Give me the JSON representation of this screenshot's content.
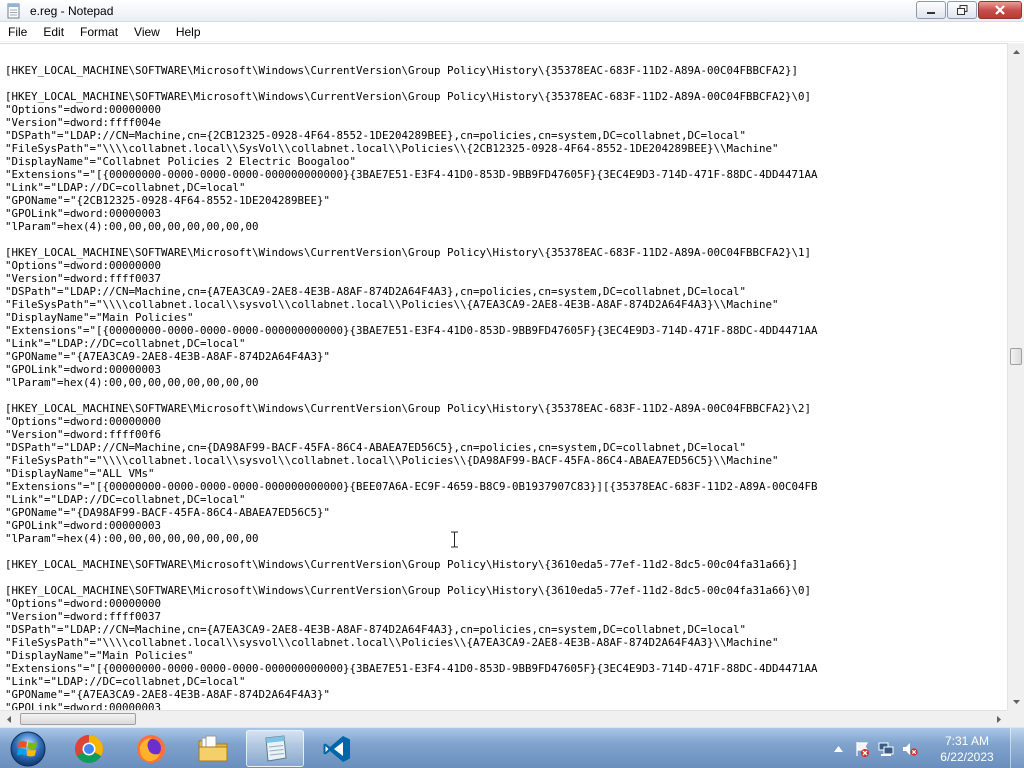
{
  "window": {
    "title": "e.reg - Notepad",
    "app_icon": "notepad-icon",
    "controls": [
      "minimize-icon",
      "maximize-icon",
      "close-icon"
    ]
  },
  "menu": [
    "File",
    "Edit",
    "Format",
    "View",
    "Help"
  ],
  "editor": {
    "lines": [
      "",
      "[HKEY_LOCAL_MACHINE\\SOFTWARE\\Microsoft\\Windows\\CurrentVersion\\Group Policy\\History\\{35378EAC-683F-11D2-A89A-00C04FBBCFA2}]",
      "",
      "[HKEY_LOCAL_MACHINE\\SOFTWARE\\Microsoft\\Windows\\CurrentVersion\\Group Policy\\History\\{35378EAC-683F-11D2-A89A-00C04FBBCFA2}\\0]",
      "\"Options\"=dword:00000000",
      "\"Version\"=dword:ffff004e",
      "\"DSPath\"=\"LDAP://CN=Machine,cn={2CB12325-0928-4F64-8552-1DE204289BEE},cn=policies,cn=system,DC=collabnet,DC=local\"",
      "\"FileSysPath\"=\"\\\\\\\\collabnet.local\\\\SysVol\\\\collabnet.local\\\\Policies\\\\{2CB12325-0928-4F64-8552-1DE204289BEE}\\\\Machine\"",
      "\"DisplayName\"=\"Collabnet Policies 2 Electric Boogaloo\"",
      "\"Extensions\"=\"[{00000000-0000-0000-0000-000000000000}{3BAE7E51-E3F4-41D0-853D-9BB9FD47605F}{3EC4E9D3-714D-471F-88DC-4DD4471AA",
      "\"Link\"=\"LDAP://DC=collabnet,DC=local\"",
      "\"GPOName\"=\"{2CB12325-0928-4F64-8552-1DE204289BEE}\"",
      "\"GPOLink\"=dword:00000003",
      "\"lParam\"=hex(4):00,00,00,00,00,00,00,00",
      "",
      "[HKEY_LOCAL_MACHINE\\SOFTWARE\\Microsoft\\Windows\\CurrentVersion\\Group Policy\\History\\{35378EAC-683F-11D2-A89A-00C04FBBCFA2}\\1]",
      "\"Options\"=dword:00000000",
      "\"Version\"=dword:ffff0037",
      "\"DSPath\"=\"LDAP://CN=Machine,cn={A7EA3CA9-2AE8-4E3B-A8AF-874D2A64F4A3},cn=policies,cn=system,DC=collabnet,DC=local\"",
      "\"FileSysPath\"=\"\\\\\\\\collabnet.local\\\\sysvol\\\\collabnet.local\\\\Policies\\\\{A7EA3CA9-2AE8-4E3B-A8AF-874D2A64F4A3}\\\\Machine\"",
      "\"DisplayName\"=\"Main Policies\"",
      "\"Extensions\"=\"[{00000000-0000-0000-0000-000000000000}{3BAE7E51-E3F4-41D0-853D-9BB9FD47605F}{3EC4E9D3-714D-471F-88DC-4DD4471AA",
      "\"Link\"=\"LDAP://DC=collabnet,DC=local\"",
      "\"GPOName\"=\"{A7EA3CA9-2AE8-4E3B-A8AF-874D2A64F4A3}\"",
      "\"GPOLink\"=dword:00000003",
      "\"lParam\"=hex(4):00,00,00,00,00,00,00,00",
      "",
      "[HKEY_LOCAL_MACHINE\\SOFTWARE\\Microsoft\\Windows\\CurrentVersion\\Group Policy\\History\\{35378EAC-683F-11D2-A89A-00C04FBBCFA2}\\2]",
      "\"Options\"=dword:00000000",
      "\"Version\"=dword:ffff00f6",
      "\"DSPath\"=\"LDAP://CN=Machine,cn={DA98AF99-BACF-45FA-86C4-ABAEA7ED56C5},cn=policies,cn=system,DC=collabnet,DC=local\"",
      "\"FileSysPath\"=\"\\\\\\\\collabnet.local\\\\sysvol\\\\collabnet.local\\\\Policies\\\\{DA98AF99-BACF-45FA-86C4-ABAEA7ED56C5}\\\\Machine\"",
      "\"DisplayName\"=\"ALL VMs\"",
      "\"Extensions\"=\"[{00000000-0000-0000-0000-000000000000}{BEE07A6A-EC9F-4659-B8C9-0B1937907C83}][{35378EAC-683F-11D2-A89A-00C04FB",
      "\"Link\"=\"LDAP://DC=collabnet,DC=local\"",
      "\"GPOName\"=\"{DA98AF99-BACF-45FA-86C4-ABAEA7ED56C5}\"",
      "\"GPOLink\"=dword:00000003",
      "\"lParam\"=hex(4):00,00,00,00,00,00,00,00",
      "",
      "[HKEY_LOCAL_MACHINE\\SOFTWARE\\Microsoft\\Windows\\CurrentVersion\\Group Policy\\History\\{3610eda5-77ef-11d2-8dc5-00c04fa31a66}]",
      "",
      "[HKEY_LOCAL_MACHINE\\SOFTWARE\\Microsoft\\Windows\\CurrentVersion\\Group Policy\\History\\{3610eda5-77ef-11d2-8dc5-00c04fa31a66}\\0]",
      "\"Options\"=dword:00000000",
      "\"Version\"=dword:ffff0037",
      "\"DSPath\"=\"LDAP://CN=Machine,cn={A7EA3CA9-2AE8-4E3B-A8AF-874D2A64F4A3},cn=policies,cn=system,DC=collabnet,DC=local\"",
      "\"FileSysPath\"=\"\\\\\\\\collabnet.local\\\\sysvol\\\\collabnet.local\\\\Policies\\\\{A7EA3CA9-2AE8-4E3B-A8AF-874D2A64F4A3}\\\\Machine\"",
      "\"DisplayName\"=\"Main Policies\"",
      "\"Extensions\"=\"[{00000000-0000-0000-0000-000000000000}{3BAE7E51-E3F4-41D0-853D-9BB9FD47605F}{3EC4E9D3-714D-471F-88DC-4DD4471AA",
      "\"Link\"=\"LDAP://DC=collabnet,DC=local\"",
      "\"GPOName\"=\"{A7EA3CA9-2AE8-4E3B-A8AF-874D2A64F4A3}\"",
      "\"GPOLink\"=dword:00000003"
    ]
  },
  "taskbar": {
    "start_icon": "windows-start-icon",
    "apps": [
      {
        "icon": "chrome-icon"
      },
      {
        "icon": "firefox-icon"
      },
      {
        "icon": "file-explorer-icon"
      },
      {
        "icon": "notepad-icon",
        "active": true
      },
      {
        "icon": "vscode-icon"
      }
    ],
    "tray_icons": [
      "show-hidden-icons-icon",
      "action-center-icon",
      "network-icon",
      "volume-muted-icon"
    ],
    "clock": {
      "time": "7:31 AM",
      "date": "6/22/2023"
    }
  }
}
